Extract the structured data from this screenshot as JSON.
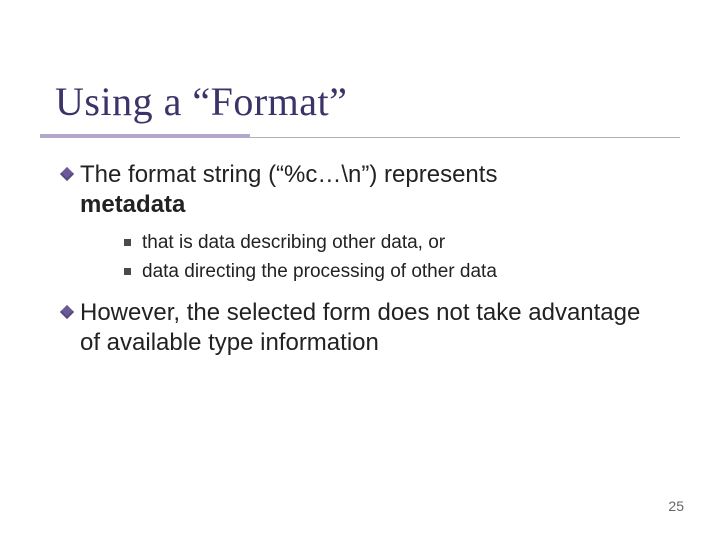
{
  "title": "Using a “Format”",
  "bullets": {
    "b1": {
      "line1": "The format string (“%c…\\n”) represents",
      "line2_strong": "metadata"
    },
    "sub": [
      "that is data describing other data, or",
      "data directing the processing of other data"
    ],
    "b2": "However, the selected form does not take advantage of available type information"
  },
  "page_number": "25"
}
